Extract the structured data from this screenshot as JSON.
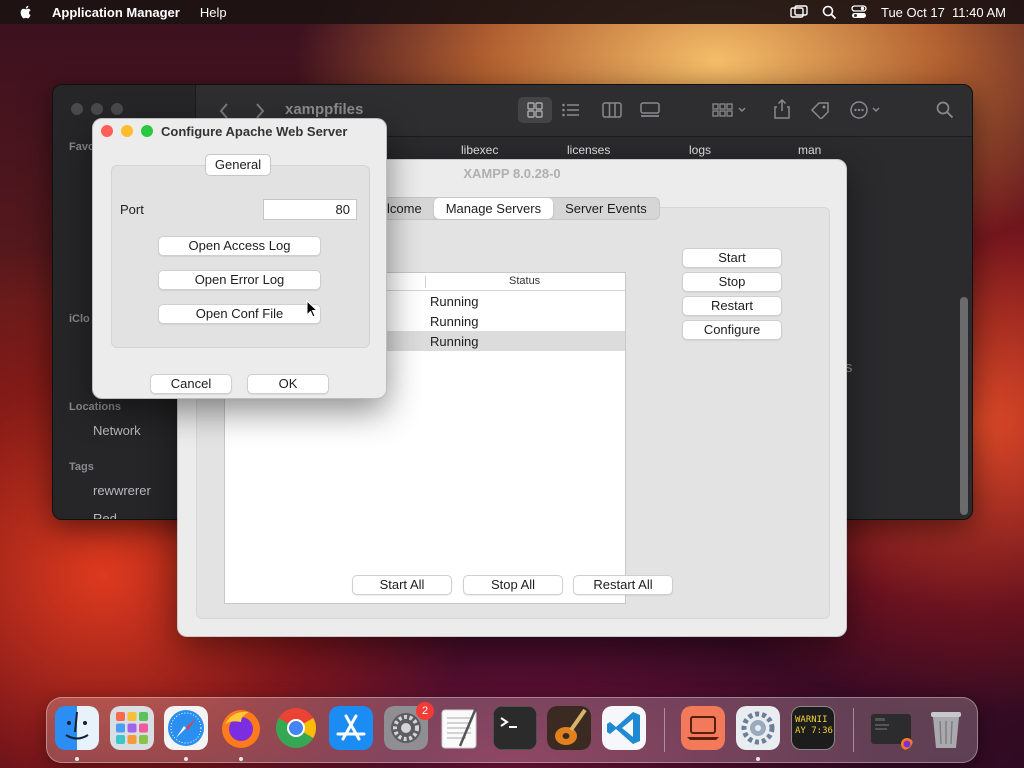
{
  "menubar": {
    "app_name": "Application Manager",
    "menus": [
      "Help"
    ],
    "datetime": "Tue Oct 17  11:40 AM"
  },
  "finder": {
    "path_title": "xamppfiles",
    "sidebar": {
      "favorites_label": "Favo",
      "icloud_label": "iClo",
      "locations_label": "Locations",
      "network_item": "Network",
      "tags_label": "Tags",
      "tag_1": "rewwrerer",
      "tag_2": "Red"
    },
    "columns": [
      "libexec",
      "licenses",
      "logs",
      "man"
    ],
    "ghost_text": "s"
  },
  "xampp": {
    "title": "XAMPP 8.0.28-0",
    "tabs": [
      "lcome",
      "Manage Servers",
      "Server Events"
    ],
    "list_header": "Status",
    "rows": [
      {
        "status": "Running"
      },
      {
        "status": "Running"
      },
      {
        "status": "Running"
      }
    ],
    "buttons": {
      "start": "Start",
      "stop": "Stop",
      "restart": "Restart",
      "configure": "Configure",
      "start_all": "Start All",
      "stop_all": "Stop All",
      "restart_all": "Restart All"
    }
  },
  "dialog": {
    "title": "Configure Apache Web Server",
    "segment": "General",
    "port_label": "Port",
    "port_value": "80",
    "buttons": {
      "access_log": "Open Access Log",
      "error_log": "Open Error Log",
      "conf_file": "Open Conf File",
      "cancel": "Cancel",
      "ok": "OK"
    }
  },
  "dock": {
    "apps": [
      "finder-icon",
      "launchpad-icon",
      "safari-icon",
      "firefox-icon",
      "chrome-icon",
      "app-store-icon",
      "system-settings-icon",
      "textedit-icon",
      "terminal-icon",
      "garageband-icon",
      "vscode-icon",
      "macbook-icon",
      "system-preferences-icon",
      "console-icon",
      "screen-icon",
      "trash-icon"
    ],
    "settings_badge": "2",
    "console_text": "WARNII\nAY 7:36"
  },
  "colors": {
    "close": "#ff5f57",
    "minimize": "#febc2e",
    "zoom": "#28c840",
    "selected_row": "#dcdcdc"
  }
}
